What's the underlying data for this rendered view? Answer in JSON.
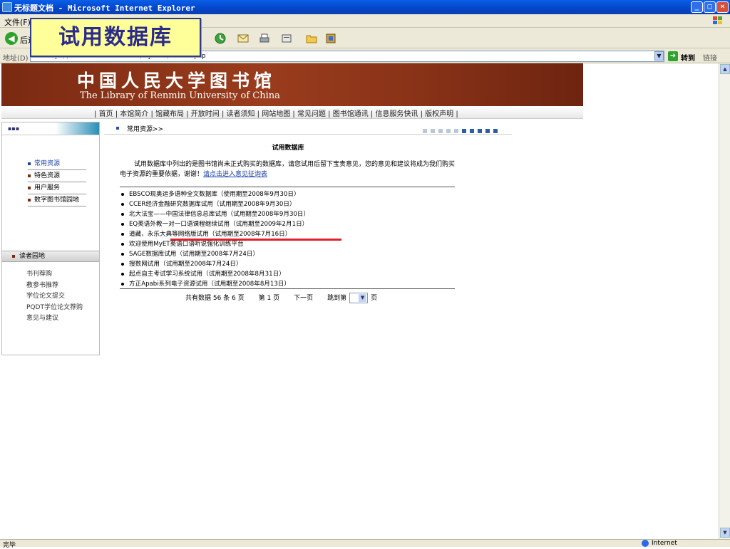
{
  "window": {
    "title": "无标题文档 - Microsoft Internet Explorer",
    "btn_minimize": "_",
    "btn_maximize": "□",
    "btn_close": "×"
  },
  "menubar": {
    "items": [
      "文件(F)"
    ]
  },
  "toolbar": {
    "back_label": "后退"
  },
  "overlay": {
    "caption": "试用数据库"
  },
  "addressbar": {
    "label": "地址(D)",
    "url": "http://www.lib.ruc.edu.cn/sydata/index.php",
    "go_label": "转到",
    "links_label": "链接"
  },
  "statusbar": {
    "status": "完毕",
    "zone": "Internet"
  },
  "banner": {
    "cn_name": "中国人民大学图书馆",
    "en_name": "The Library of Renmin University of China"
  },
  "topnav": {
    "items": [
      "首页",
      "本馆简介",
      "馆藏布局",
      "开放时间",
      "读者须知",
      "网站地图",
      "常见问题",
      "图书馆通讯",
      "信息服务快讯",
      "版权声明"
    ]
  },
  "sidebar": {
    "menu": [
      {
        "label": "常用资源",
        "active": true
      },
      {
        "label": "特色资源",
        "active": false
      },
      {
        "label": "用户服务",
        "active": false
      },
      {
        "label": "数字图书馆园地",
        "active": false
      }
    ],
    "reader_title": "读者园地",
    "reader_links": [
      "书刊荐购",
      "教参书推荐",
      "学位论文提交",
      "PQDT学位论文荐购",
      "意见与建议"
    ]
  },
  "breadcrumb": {
    "text": "常用资源>>"
  },
  "main": {
    "title": "试用数据库",
    "intro": "试用数据库中列出的是图书馆尚未正式购买的数据库，请您试用后留下宝贵意见，您的意见和建议将成为我们购买电子资源的重要依据，谢谢！",
    "intro_link": "请点击进入意见征询表",
    "databases": [
      "EBSCO现奥运多语种全文数据库（使用期至2008年9月30日）",
      "CCER经济金融研究数据库试用（试用期至2008年9月30日）",
      "北大法宝——中国法律信息总库试用（试用期至2008年9月30日）",
      "EQ英语外教一对一口语课程继续试用（试用期至2009年2月1日）",
      "道藏、永乐大典等网络版试用（试用期至2008年7月16日）",
      "欢迎使用MyET英语口语听说强化训练平台",
      "SAGE数据库试用（试用期至2008年7月24日）",
      "搜数网试用（试用期至2008年7月24日）",
      "起点自主考试学习系统试用（试用期至2008年8月31日）",
      "方正Apabi系列电子资源试用（试用期至2008年8月13日）"
    ]
  },
  "pager": {
    "total": "共有数据 56 条 6 页",
    "current": "第 1 页",
    "next": "下一页",
    "jump_label": "跳到第",
    "page_suffix": "页"
  }
}
